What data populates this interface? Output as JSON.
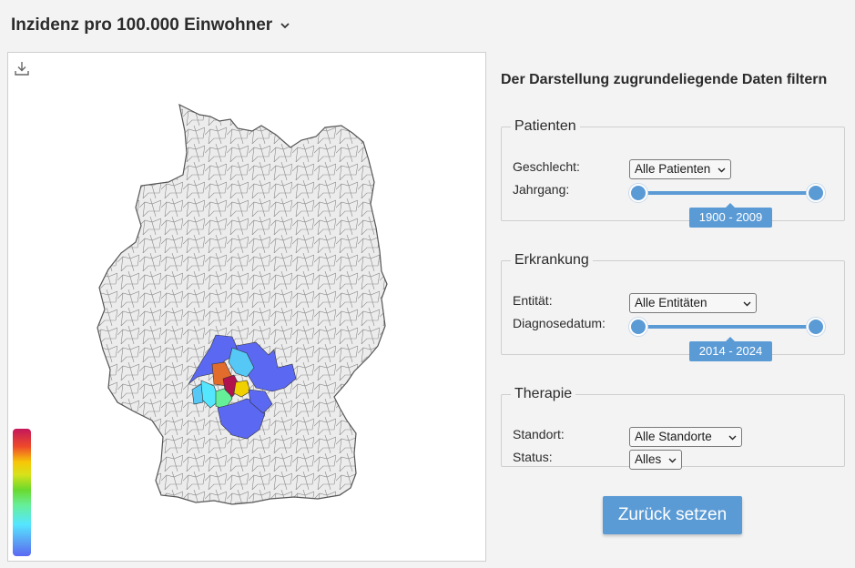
{
  "header": {
    "title": "Inzidenz pro 100.000 Einwohner",
    "dropdown_icon": "chevron-down-icon"
  },
  "map": {
    "download_icon": "download-icon",
    "legend_colors": [
      "#5b68f2",
      "#55e6ff",
      "#6ad92e",
      "#f7c607",
      "#c4175b"
    ],
    "highlight_colors": {
      "low": "#5b68f2",
      "mid_low": "#55c8f5",
      "mid": "#66ef99",
      "high": "#e26c2c",
      "top": "#b0124e",
      "yellow": "#f1d000"
    }
  },
  "filters": {
    "title": "Der Darstellung zugrundeliegende Daten filtern",
    "patienten": {
      "legend": "Patienten",
      "geschlecht_label": "Geschlecht:",
      "geschlecht_value": "Alle Patienten",
      "jahrgang_label": "Jahrgang:",
      "jahrgang_range": "1900 - 2009"
    },
    "erkrankung": {
      "legend": "Erkrankung",
      "entitaet_label": "Entität:",
      "entitaet_value": "Alle Entitäten",
      "diagnosedatum_label": "Diagnosedatum:",
      "diagnosedatum_range": "2014 - 2024"
    },
    "therapie": {
      "legend": "Therapie",
      "standort_label": "Standort:",
      "standort_value": "Alle Standorte",
      "status_label": "Status:",
      "status_value": "Alles"
    },
    "reset_label": "Zurück setzen"
  }
}
